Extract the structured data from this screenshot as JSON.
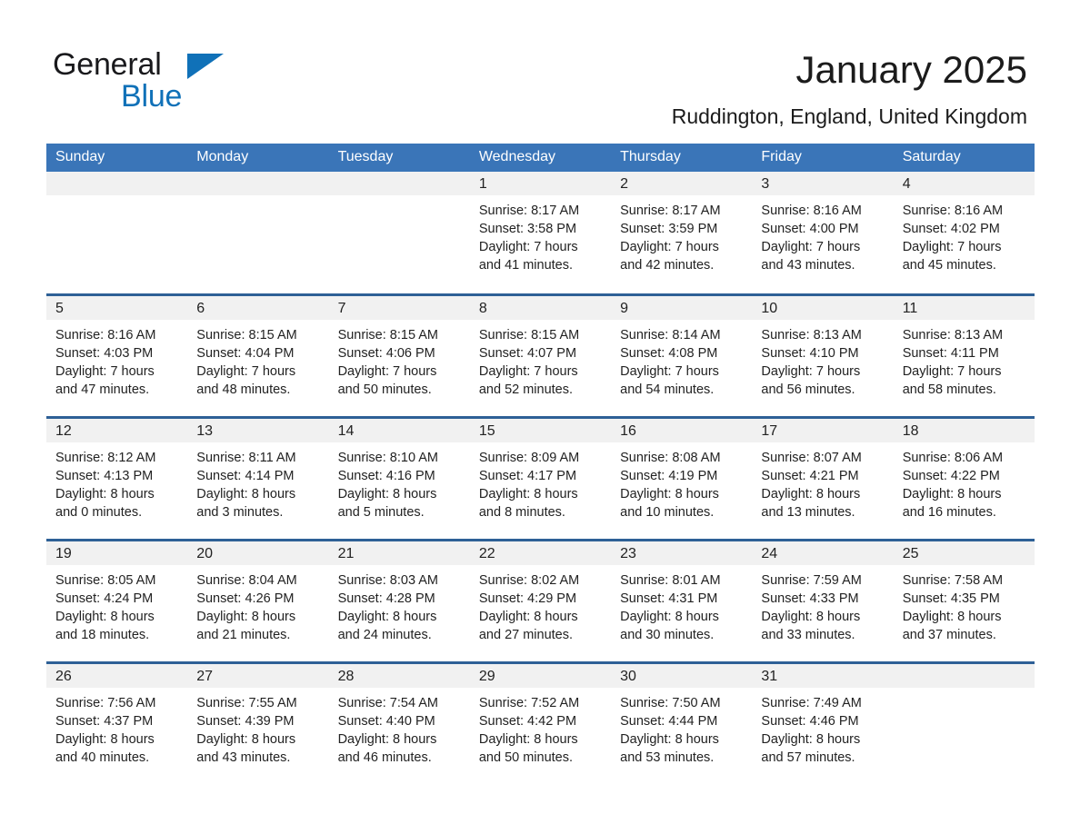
{
  "brand": {
    "name_part1": "General",
    "name_part2": "Blue",
    "accent_color": "#1071b8"
  },
  "header": {
    "title": "January 2025",
    "subtitle": "Ruddington, England, United Kingdom",
    "header_bg_color": "#3a75b8",
    "row_divider_color": "#2e6096",
    "daynum_bg_color": "#f1f1f1"
  },
  "weekday_headers": [
    "Sunday",
    "Monday",
    "Tuesday",
    "Wednesday",
    "Thursday",
    "Friday",
    "Saturday"
  ],
  "weeks": [
    [
      {
        "day": "",
        "empty": true
      },
      {
        "day": "",
        "empty": true
      },
      {
        "day": "",
        "empty": true
      },
      {
        "day": "1",
        "sunrise": "Sunrise: 8:17 AM",
        "sunset": "Sunset: 3:58 PM",
        "daylight_line1": "Daylight: 7 hours",
        "daylight_line2": "and 41 minutes."
      },
      {
        "day": "2",
        "sunrise": "Sunrise: 8:17 AM",
        "sunset": "Sunset: 3:59 PM",
        "daylight_line1": "Daylight: 7 hours",
        "daylight_line2": "and 42 minutes."
      },
      {
        "day": "3",
        "sunrise": "Sunrise: 8:16 AM",
        "sunset": "Sunset: 4:00 PM",
        "daylight_line1": "Daylight: 7 hours",
        "daylight_line2": "and 43 minutes."
      },
      {
        "day": "4",
        "sunrise": "Sunrise: 8:16 AM",
        "sunset": "Sunset: 4:02 PM",
        "daylight_line1": "Daylight: 7 hours",
        "daylight_line2": "and 45 minutes."
      }
    ],
    [
      {
        "day": "5",
        "sunrise": "Sunrise: 8:16 AM",
        "sunset": "Sunset: 4:03 PM",
        "daylight_line1": "Daylight: 7 hours",
        "daylight_line2": "and 47 minutes."
      },
      {
        "day": "6",
        "sunrise": "Sunrise: 8:15 AM",
        "sunset": "Sunset: 4:04 PM",
        "daylight_line1": "Daylight: 7 hours",
        "daylight_line2": "and 48 minutes."
      },
      {
        "day": "7",
        "sunrise": "Sunrise: 8:15 AM",
        "sunset": "Sunset: 4:06 PM",
        "daylight_line1": "Daylight: 7 hours",
        "daylight_line2": "and 50 minutes."
      },
      {
        "day": "8",
        "sunrise": "Sunrise: 8:15 AM",
        "sunset": "Sunset: 4:07 PM",
        "daylight_line1": "Daylight: 7 hours",
        "daylight_line2": "and 52 minutes."
      },
      {
        "day": "9",
        "sunrise": "Sunrise: 8:14 AM",
        "sunset": "Sunset: 4:08 PM",
        "daylight_line1": "Daylight: 7 hours",
        "daylight_line2": "and 54 minutes."
      },
      {
        "day": "10",
        "sunrise": "Sunrise: 8:13 AM",
        "sunset": "Sunset: 4:10 PM",
        "daylight_line1": "Daylight: 7 hours",
        "daylight_line2": "and 56 minutes."
      },
      {
        "day": "11",
        "sunrise": "Sunrise: 8:13 AM",
        "sunset": "Sunset: 4:11 PM",
        "daylight_line1": "Daylight: 7 hours",
        "daylight_line2": "and 58 minutes."
      }
    ],
    [
      {
        "day": "12",
        "sunrise": "Sunrise: 8:12 AM",
        "sunset": "Sunset: 4:13 PM",
        "daylight_line1": "Daylight: 8 hours",
        "daylight_line2": "and 0 minutes."
      },
      {
        "day": "13",
        "sunrise": "Sunrise: 8:11 AM",
        "sunset": "Sunset: 4:14 PM",
        "daylight_line1": "Daylight: 8 hours",
        "daylight_line2": "and 3 minutes."
      },
      {
        "day": "14",
        "sunrise": "Sunrise: 8:10 AM",
        "sunset": "Sunset: 4:16 PM",
        "daylight_line1": "Daylight: 8 hours",
        "daylight_line2": "and 5 minutes."
      },
      {
        "day": "15",
        "sunrise": "Sunrise: 8:09 AM",
        "sunset": "Sunset: 4:17 PM",
        "daylight_line1": "Daylight: 8 hours",
        "daylight_line2": "and 8 minutes."
      },
      {
        "day": "16",
        "sunrise": "Sunrise: 8:08 AM",
        "sunset": "Sunset: 4:19 PM",
        "daylight_line1": "Daylight: 8 hours",
        "daylight_line2": "and 10 minutes."
      },
      {
        "day": "17",
        "sunrise": "Sunrise: 8:07 AM",
        "sunset": "Sunset: 4:21 PM",
        "daylight_line1": "Daylight: 8 hours",
        "daylight_line2": "and 13 minutes."
      },
      {
        "day": "18",
        "sunrise": "Sunrise: 8:06 AM",
        "sunset": "Sunset: 4:22 PM",
        "daylight_line1": "Daylight: 8 hours",
        "daylight_line2": "and 16 minutes."
      }
    ],
    [
      {
        "day": "19",
        "sunrise": "Sunrise: 8:05 AM",
        "sunset": "Sunset: 4:24 PM",
        "daylight_line1": "Daylight: 8 hours",
        "daylight_line2": "and 18 minutes."
      },
      {
        "day": "20",
        "sunrise": "Sunrise: 8:04 AM",
        "sunset": "Sunset: 4:26 PM",
        "daylight_line1": "Daylight: 8 hours",
        "daylight_line2": "and 21 minutes."
      },
      {
        "day": "21",
        "sunrise": "Sunrise: 8:03 AM",
        "sunset": "Sunset: 4:28 PM",
        "daylight_line1": "Daylight: 8 hours",
        "daylight_line2": "and 24 minutes."
      },
      {
        "day": "22",
        "sunrise": "Sunrise: 8:02 AM",
        "sunset": "Sunset: 4:29 PM",
        "daylight_line1": "Daylight: 8 hours",
        "daylight_line2": "and 27 minutes."
      },
      {
        "day": "23",
        "sunrise": "Sunrise: 8:01 AM",
        "sunset": "Sunset: 4:31 PM",
        "daylight_line1": "Daylight: 8 hours",
        "daylight_line2": "and 30 minutes."
      },
      {
        "day": "24",
        "sunrise": "Sunrise: 7:59 AM",
        "sunset": "Sunset: 4:33 PM",
        "daylight_line1": "Daylight: 8 hours",
        "daylight_line2": "and 33 minutes."
      },
      {
        "day": "25",
        "sunrise": "Sunrise: 7:58 AM",
        "sunset": "Sunset: 4:35 PM",
        "daylight_line1": "Daylight: 8 hours",
        "daylight_line2": "and 37 minutes."
      }
    ],
    [
      {
        "day": "26",
        "sunrise": "Sunrise: 7:56 AM",
        "sunset": "Sunset: 4:37 PM",
        "daylight_line1": "Daylight: 8 hours",
        "daylight_line2": "and 40 minutes."
      },
      {
        "day": "27",
        "sunrise": "Sunrise: 7:55 AM",
        "sunset": "Sunset: 4:39 PM",
        "daylight_line1": "Daylight: 8 hours",
        "daylight_line2": "and 43 minutes."
      },
      {
        "day": "28",
        "sunrise": "Sunrise: 7:54 AM",
        "sunset": "Sunset: 4:40 PM",
        "daylight_line1": "Daylight: 8 hours",
        "daylight_line2": "and 46 minutes."
      },
      {
        "day": "29",
        "sunrise": "Sunrise: 7:52 AM",
        "sunset": "Sunset: 4:42 PM",
        "daylight_line1": "Daylight: 8 hours",
        "daylight_line2": "and 50 minutes."
      },
      {
        "day": "30",
        "sunrise": "Sunrise: 7:50 AM",
        "sunset": "Sunset: 4:44 PM",
        "daylight_line1": "Daylight: 8 hours",
        "daylight_line2": "and 53 minutes."
      },
      {
        "day": "31",
        "sunrise": "Sunrise: 7:49 AM",
        "sunset": "Sunset: 4:46 PM",
        "daylight_line1": "Daylight: 8 hours",
        "daylight_line2": "and 57 minutes."
      },
      {
        "day": "",
        "empty": true
      }
    ]
  ]
}
